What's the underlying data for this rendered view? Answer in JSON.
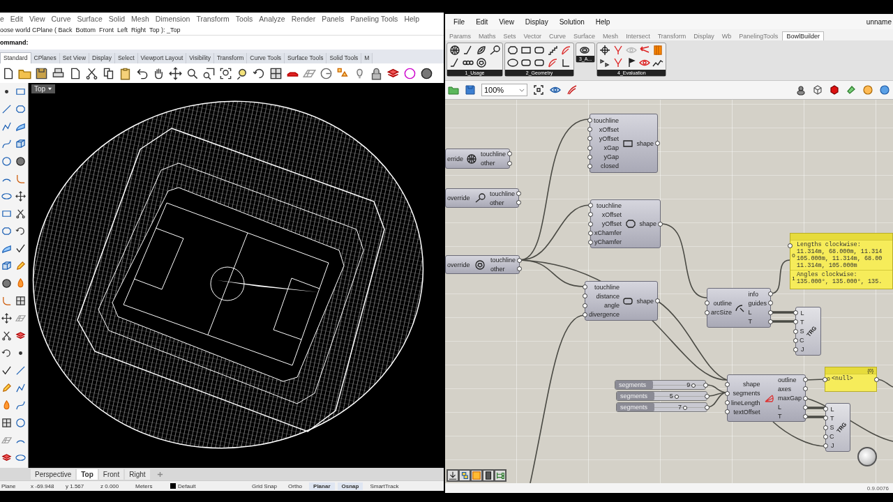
{
  "rhino": {
    "menu": [
      "e",
      "Edit",
      "View",
      "Curve",
      "Surface",
      "Solid",
      "Mesh",
      "Dimension",
      "Transform",
      "Tools",
      "Analyze",
      "Render",
      "Panels",
      "Paneling Tools",
      "Help"
    ],
    "command_history": "oose world CPlane ( Back  Bottom  Front  Left  Right  Top ): _Top",
    "command_prompt": "ommand:",
    "toolbar_tabs": [
      {
        "label": "Standard",
        "selected": true
      },
      {
        "label": "CPlanes",
        "selected": false
      },
      {
        "label": "Set View",
        "selected": false
      },
      {
        "label": "Display",
        "selected": false
      },
      {
        "label": "Select",
        "selected": false
      },
      {
        "label": "Viewport Layout",
        "selected": false
      },
      {
        "label": "Visibility",
        "selected": false
      },
      {
        "label": "Transform",
        "selected": false
      },
      {
        "label": "Curve Tools",
        "selected": false
      },
      {
        "label": "Surface Tools",
        "selected": false
      },
      {
        "label": "Solid Tools",
        "selected": false
      },
      {
        "label": "M",
        "selected": false
      }
    ],
    "viewport_label": "Top",
    "view_tabs": [
      {
        "label": "Perspective",
        "selected": false
      },
      {
        "label": "Top",
        "selected": true
      },
      {
        "label": "Front",
        "selected": false
      },
      {
        "label": "Right",
        "selected": false
      }
    ],
    "status_bar": {
      "cplane": "Plane",
      "x": "x -69.948",
      "y": "y 1.567",
      "z": "z 0.000",
      "units": "Meters",
      "layer": "Default",
      "toggles": [
        {
          "label": "Grid Snap",
          "on": false
        },
        {
          "label": "Ortho",
          "on": false
        },
        {
          "label": "Planar",
          "on": true
        },
        {
          "label": "Osnap",
          "on": true
        },
        {
          "label": "SmartTrack",
          "on": false
        }
      ]
    }
  },
  "grasshopper": {
    "menu": [
      "File",
      "Edit",
      "View",
      "Display",
      "Solution",
      "Help"
    ],
    "document_title": "unname",
    "tabs": [
      {
        "label": "Params",
        "selected": false
      },
      {
        "label": "Maths",
        "selected": false
      },
      {
        "label": "Sets",
        "selected": false
      },
      {
        "label": "Vector",
        "selected": false
      },
      {
        "label": "Curve",
        "selected": false
      },
      {
        "label": "Surface",
        "selected": false
      },
      {
        "label": "Mesh",
        "selected": false
      },
      {
        "label": "Intersect",
        "selected": false
      },
      {
        "label": "Transform",
        "selected": false
      },
      {
        "label": "Display",
        "selected": false
      },
      {
        "label": "Wb",
        "selected": false
      },
      {
        "label": "PanelingTools",
        "selected": false
      },
      {
        "label": "BowlBuilder",
        "selected": true
      }
    ],
    "ribbon_groups": [
      "1_Usage",
      "2_Geometry",
      "3_A...",
      "4_Evaluation"
    ],
    "zoom": "100%",
    "nodes": [
      {
        "kind": "param",
        "input": "erride",
        "outputs": [
          "touchline",
          "other"
        ]
      },
      {
        "kind": "param",
        "input": "override",
        "outputs": [
          "touchline",
          "other"
        ]
      },
      {
        "kind": "component",
        "inputs": [
          "touchline",
          "xOffset",
          "yOffset",
          "xGap",
          "yGap",
          "closed"
        ],
        "outputs": [
          "shape"
        ]
      },
      {
        "kind": "component",
        "inputs": [
          "touchline",
          "xOffset",
          "yOffset",
          "xChamfer",
          "yChamfer"
        ],
        "outputs": [
          "shape"
        ]
      },
      {
        "kind": "param",
        "input": "override",
        "outputs": [
          "touchline",
          "other"
        ]
      },
      {
        "kind": "component",
        "inputs": [
          "touchline",
          "distance",
          "angle",
          "divergence"
        ],
        "outputs": [
          "shape"
        ]
      },
      {
        "kind": "component",
        "inputs": [
          "outline",
          "arcSize"
        ],
        "outputs": [
          "info",
          "guides",
          "L",
          "T"
        ]
      },
      {
        "kind": "panel",
        "items": [
          {
            "index": "0",
            "lines": [
              "Lengths clockwise:",
              "11.314m, 68.000m, 11.314",
              "105.000m, 11.314m, 68.00",
              "11.314m, 105.000m"
            ]
          },
          {
            "index": "1",
            "lines": [
              "Angles clockwise:",
              "135.000°, 135.000°, 135."
            ]
          }
        ]
      },
      {
        "kind": "cluster",
        "label": "TRG",
        "inputs": [
          "L",
          "T",
          "S",
          "C",
          "J"
        ]
      },
      {
        "kind": "slider",
        "label": "segments",
        "value": "9",
        "level": 0.81
      },
      {
        "kind": "slider",
        "label": "segments",
        "value": "5",
        "level": 0.44
      },
      {
        "kind": "slider",
        "label": "segments",
        "value": "7",
        "level": 0.61
      },
      {
        "kind": "component",
        "inputs": [
          "shape",
          "segments",
          "lineLength",
          "textOffset"
        ],
        "outputs": [
          "outline",
          "axes",
          "maxGap",
          "L",
          "T"
        ]
      },
      {
        "kind": "panel",
        "header": "{0}",
        "items": [
          {
            "index": "0",
            "lines": [
              "<null>"
            ]
          }
        ]
      },
      {
        "kind": "cluster",
        "label": "TRG",
        "inputs": [
          "L",
          "T",
          "S",
          "C",
          "J"
        ]
      },
      {
        "kind": "dial"
      }
    ],
    "version": "0.9.0076"
  }
}
